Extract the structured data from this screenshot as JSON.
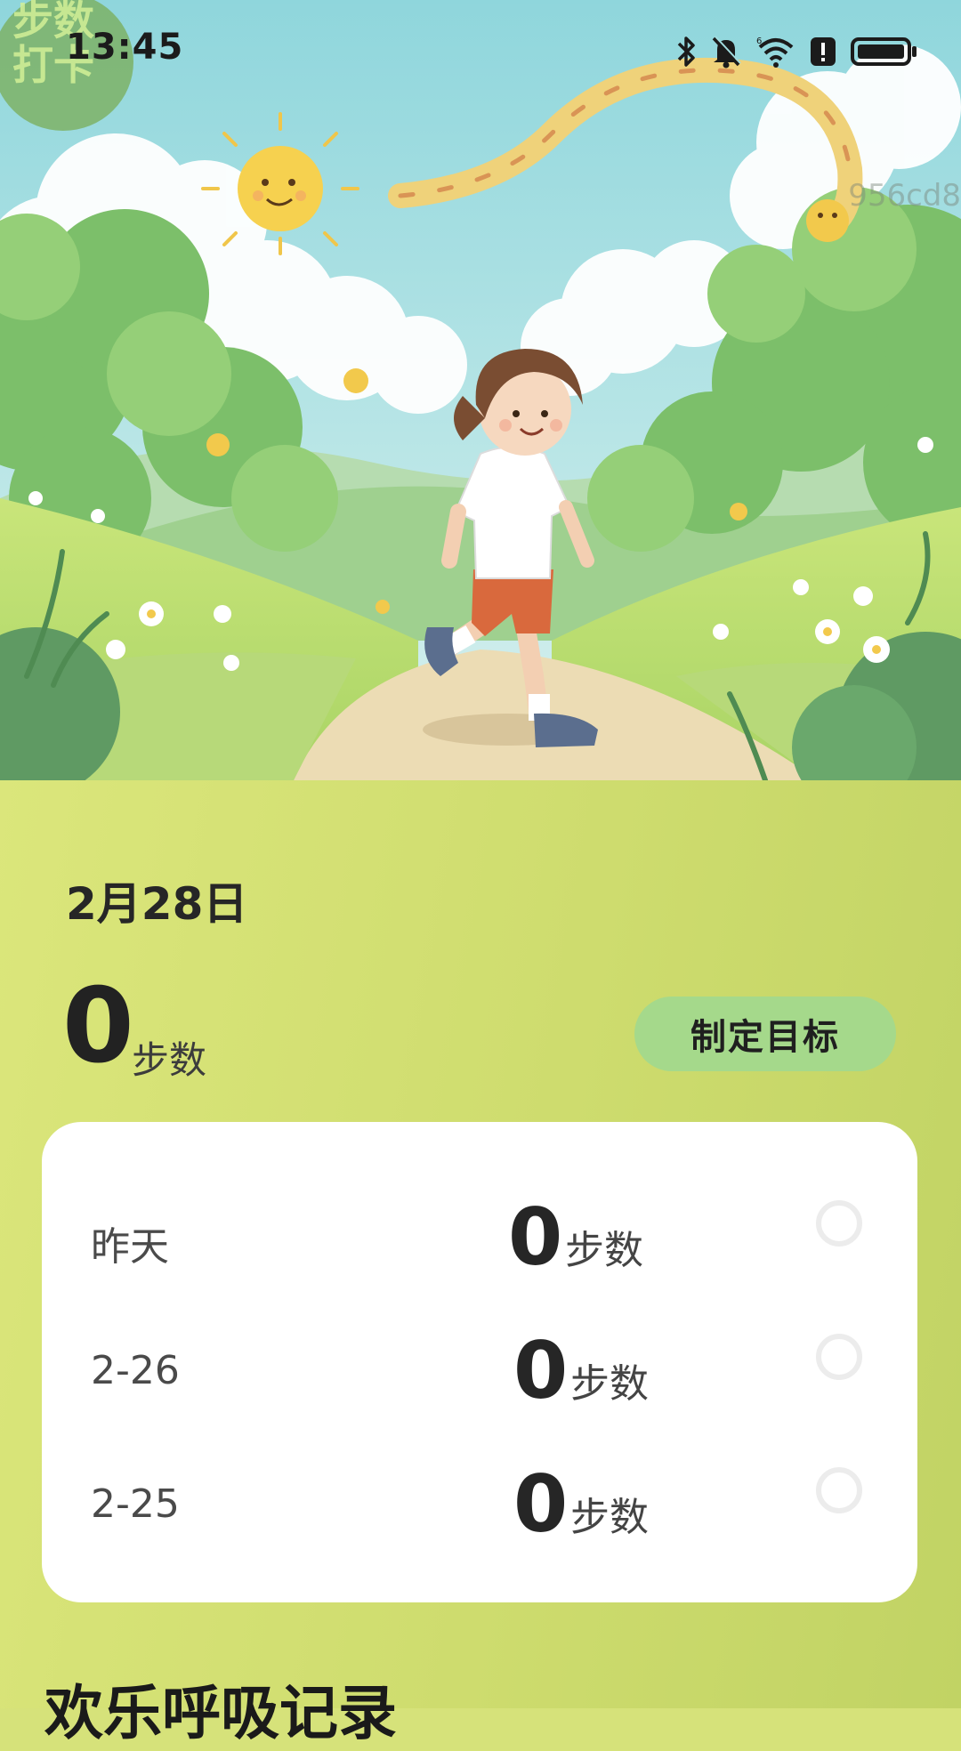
{
  "status_bar": {
    "time": "13:45",
    "app_badge_text": "步数打卡",
    "icons": [
      "bluetooth-icon",
      "mute-bell-icon",
      "wifi-icon",
      "alert-icon",
      "battery-icon"
    ]
  },
  "hero": {
    "watermark": "956cd8"
  },
  "today": {
    "date": "2月28日",
    "steps": "0",
    "unit": "步数",
    "goal_button_label": "制定目标"
  },
  "history": [
    {
      "label": "昨天",
      "steps": "0",
      "unit": "步数"
    },
    {
      "label": "2-26",
      "steps": "0",
      "unit": "步数"
    },
    {
      "label": "2-25",
      "steps": "0",
      "unit": "步数"
    }
  ],
  "section_heading": "欢乐呼吸记录",
  "colors": {
    "panel_gradient_start": "#dbe67b",
    "panel_gradient_end": "#c1d364",
    "goal_button": "#a5d98b",
    "card": "#ffffff",
    "sky": "#a3dde0"
  }
}
